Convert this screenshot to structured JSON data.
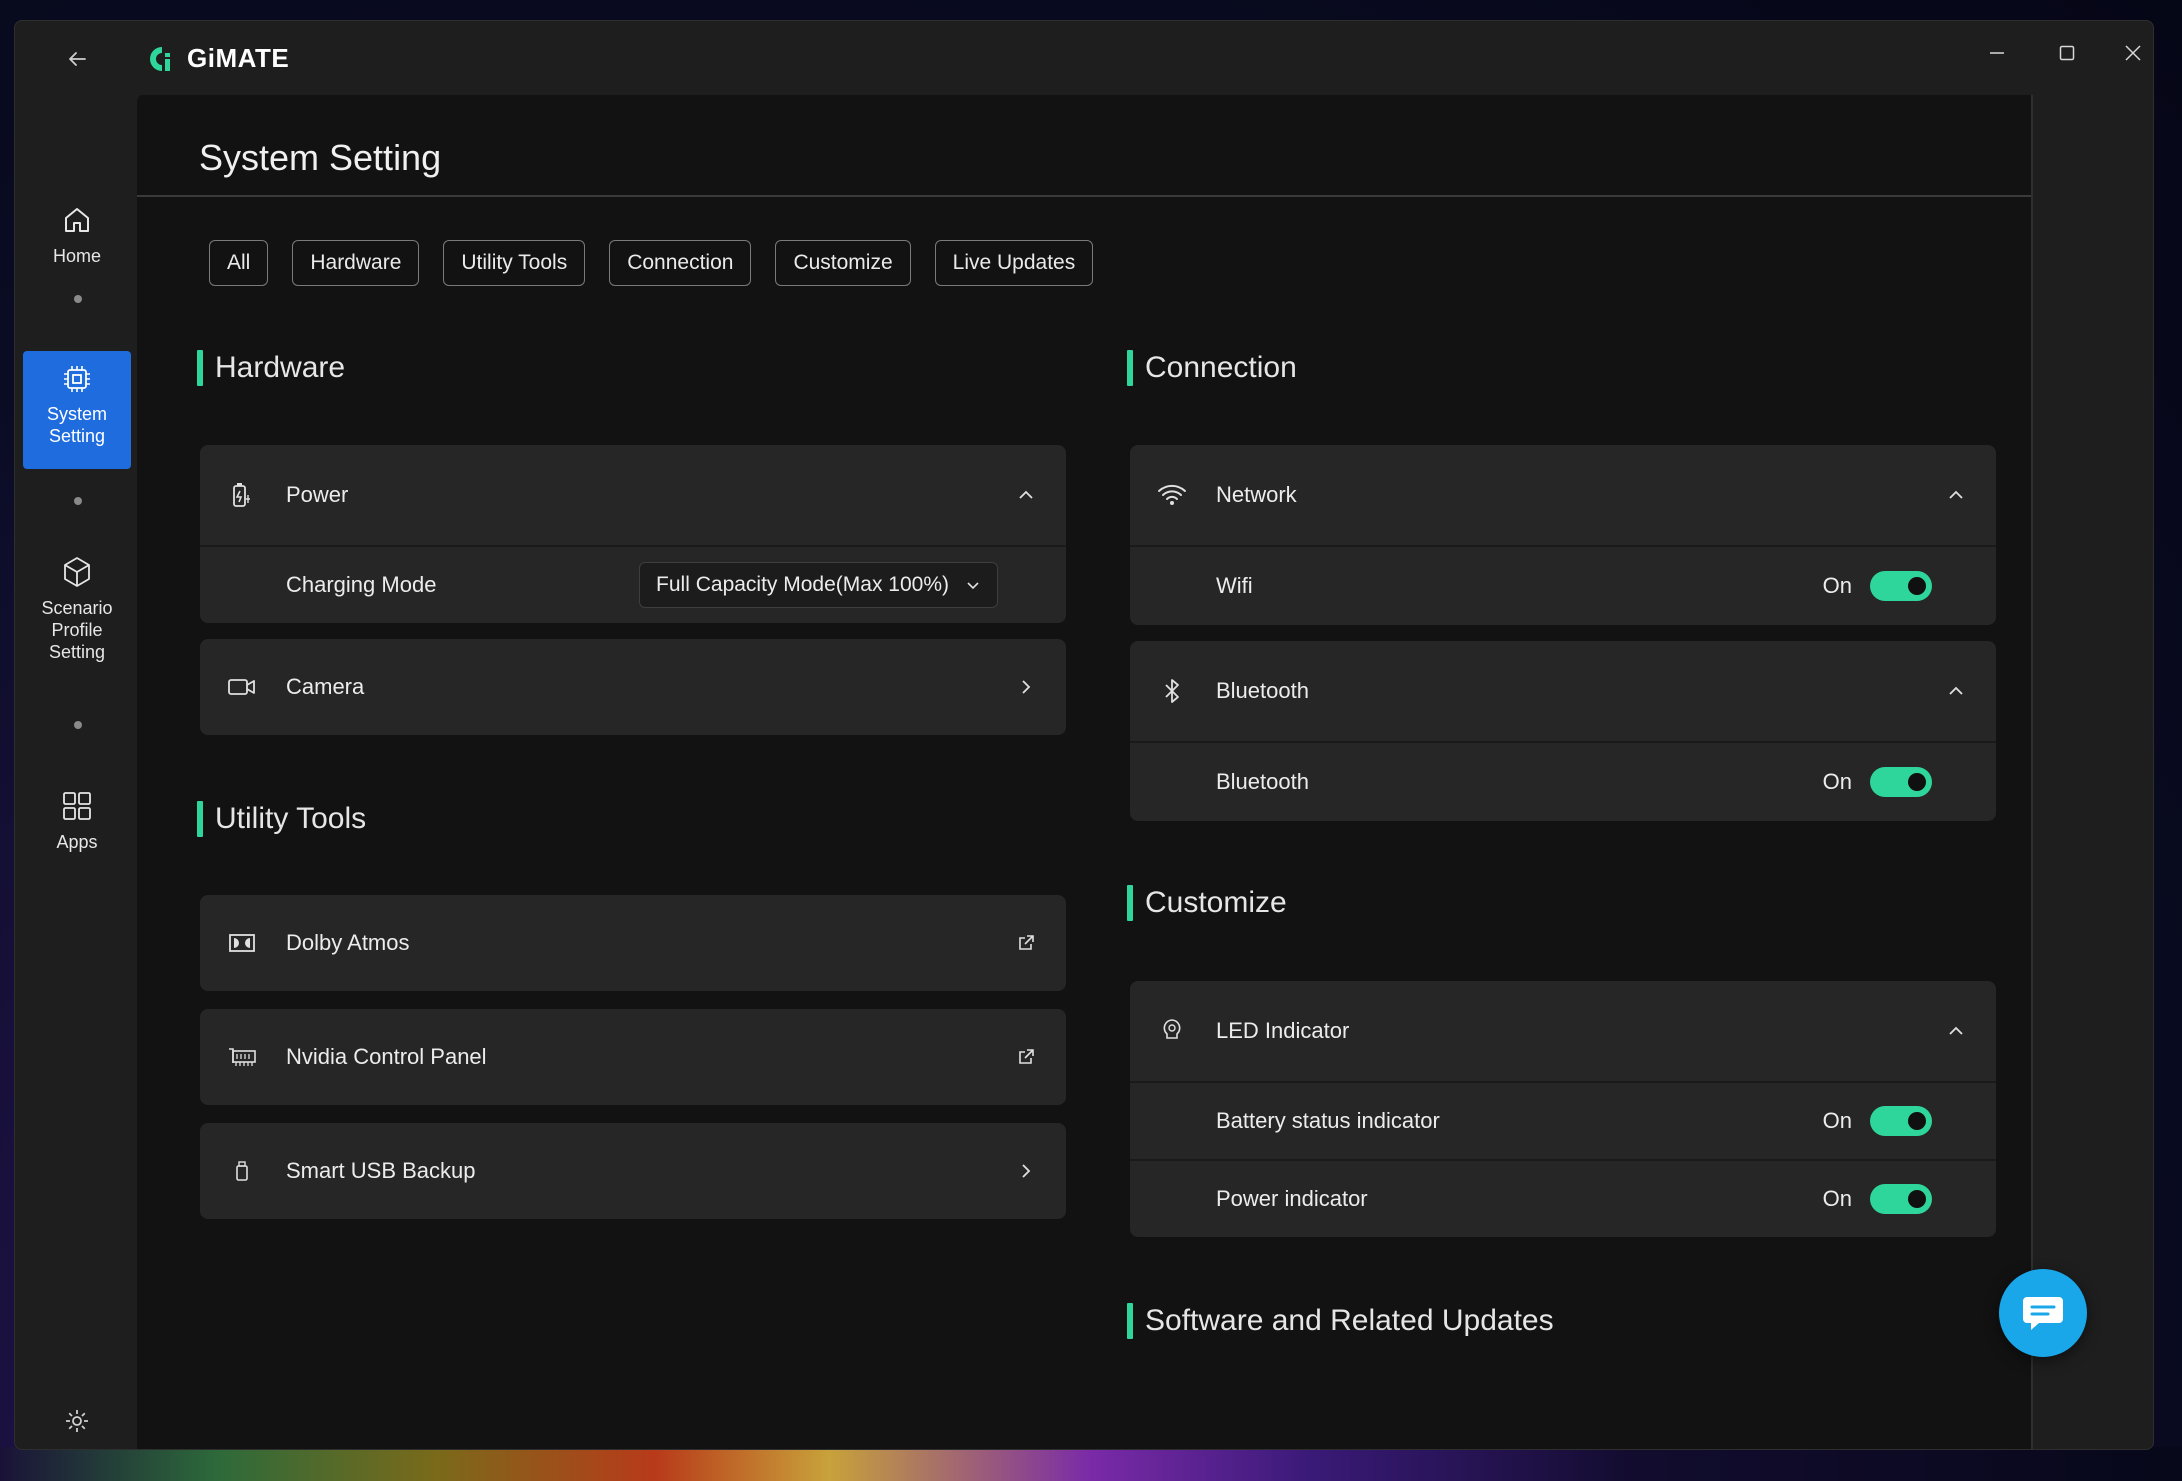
{
  "app": {
    "name": "GiMATE"
  },
  "sidebar": {
    "items": [
      {
        "label": "Home",
        "icon": "home-icon"
      },
      {
        "label": "System\nSetting",
        "icon": "chip-icon",
        "active": true
      },
      {
        "label": "Scenario\nProfile\nSetting",
        "icon": "cube-icon"
      },
      {
        "label": "Apps",
        "icon": "grid-icon"
      }
    ]
  },
  "page": {
    "title": "System Setting"
  },
  "filters": [
    "All",
    "Hardware",
    "Utility Tools",
    "Connection",
    "Customize",
    "Live Updates"
  ],
  "hardware": {
    "title": "Hardware",
    "power": {
      "label": "Power",
      "charging_label": "Charging Mode",
      "charging_value": "Full Capacity Mode(Max 100%)"
    },
    "camera": {
      "label": "Camera"
    }
  },
  "utility": {
    "title": "Utility Tools",
    "items": [
      "Dolby Atmos",
      "Nvidia Control Panel",
      "Smart USB Backup"
    ]
  },
  "connection": {
    "title": "Connection",
    "network": {
      "label": "Network",
      "wifi_label": "Wifi",
      "wifi_state": "On"
    },
    "bluetooth": {
      "label": "Bluetooth",
      "bt_label": "Bluetooth",
      "bt_state": "On"
    }
  },
  "customize": {
    "title": "Customize",
    "led": {
      "label": "LED Indicator",
      "battery_label": "Battery status indicator",
      "battery_state": "On",
      "power_label": "Power indicator",
      "power_state": "On"
    }
  },
  "updates": {
    "title": "Software and Related Updates"
  },
  "colors": {
    "accent": "#2fd69c",
    "active_nav": "#1f6cde",
    "chat": "#1aa7ea"
  }
}
